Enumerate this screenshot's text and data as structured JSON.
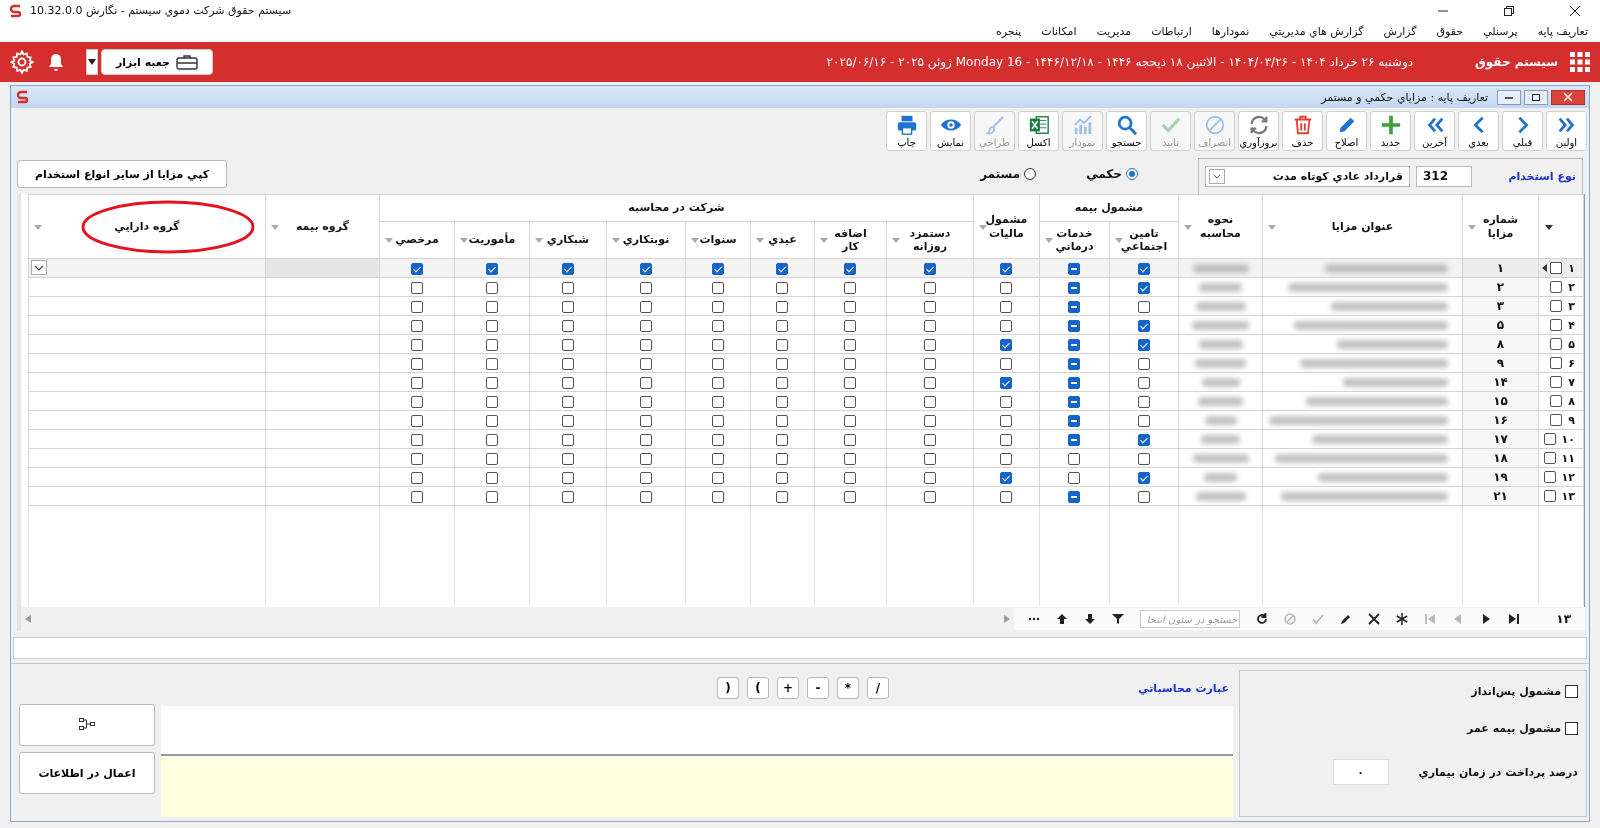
{
  "app_title": "سيستم حقوق شرکت دموي سيستم - نگارش 10.32.0.0",
  "menu": [
    "تعاريف پايه",
    "پرسنلي",
    "حقوق",
    "گزارش",
    "گزارش هاي مديريتي",
    "نمودارها",
    "ارتباطات",
    "مديريت",
    "امکانات",
    "پنجره"
  ],
  "header_bar": {
    "system_name": "سيستم حقوق",
    "date": "دوشنبه ۲۶ خرداد ۱۴۰۴ - ۱۴۰۴/۰۳/۲۶ - الاثنين ۱۸ ذيحجه ۱۴۴۶ - ۱۴۴۶/۱۲/۱۸ - Monday 16 ژوئن ۲۰۲۵ - ۲۰۲۵/۰۶/۱۶",
    "toolbox": "جعبه ابزار"
  },
  "window": {
    "title": "تعاريف پايه : مزاياي حکمي و مستمر"
  },
  "toolbar": [
    {
      "label": "اولين",
      "kind": "first",
      "disabled": false
    },
    {
      "label": "قبلي",
      "kind": "prev",
      "disabled": false
    },
    {
      "label": "بعدي",
      "kind": "next",
      "disabled": false
    },
    {
      "label": "آخرين",
      "kind": "last",
      "disabled": false
    },
    {
      "label": "جديد",
      "kind": "new",
      "disabled": false
    },
    {
      "label": "اصلاح",
      "kind": "edit",
      "disabled": false
    },
    {
      "label": "حذف",
      "kind": "delete",
      "disabled": false
    },
    {
      "label": "بروزآوري",
      "kind": "refresh",
      "disabled": false
    },
    {
      "label": "انصراف",
      "kind": "cancel",
      "disabled": true
    },
    {
      "label": "تاييد",
      "kind": "confirm",
      "disabled": true
    },
    {
      "label": "جستجو",
      "kind": "search",
      "disabled": false
    },
    {
      "label": "نمودار",
      "kind": "chart",
      "disabled": true
    },
    {
      "label": "اکسل",
      "kind": "excel",
      "disabled": false
    },
    {
      "label": "طراحي",
      "kind": "design",
      "disabled": true
    },
    {
      "label": "نمايش",
      "kind": "view",
      "disabled": false
    },
    {
      "label": "چاپ",
      "kind": "print",
      "disabled": false
    }
  ],
  "employment": {
    "label": "نوع استخدام",
    "code": "312",
    "type": "قرارداد عادي کوتاه مدت"
  },
  "calc_type": [
    {
      "label": "حکمي",
      "selected": true
    },
    {
      "label": "مستمر",
      "selected": false
    }
  ],
  "copy_button": "کپي مزايا از ساير انواع استخدام",
  "table": {
    "columns": [
      {
        "label": "شماره\nمزايا"
      },
      {
        "label": "عنوان مزايا"
      },
      {
        "label": "نحوه\nمحاسبه"
      },
      {
        "label": "مشمول بيمه",
        "children": [
          {
            "label": "تامين\nاجتماعي"
          },
          {
            "label": "خدمات\nدرماني"
          }
        ]
      },
      {
        "label": "مشمول\nماليات"
      },
      {
        "label": "شرکت در محاسبه",
        "children": [
          {
            "label": "دستمزد\nروزانه"
          },
          {
            "label": "اضافه\nکار"
          },
          {
            "label": "عيدي"
          },
          {
            "label": "سنوات"
          },
          {
            "label": "نوبتکاري"
          },
          {
            "label": "شبکاري"
          },
          {
            "label": "مأموريت"
          },
          {
            "label": "مرخصي"
          }
        ]
      },
      {
        "label": "گروه بيمه"
      },
      {
        "label": "گروه دارايي",
        "circled": true
      }
    ],
    "rows": [
      {
        "index": "۱",
        "number": "۱",
        "selected": false,
        "current": true,
        "health_partial": true,
        "checks": [
          true,
          true,
          true,
          true,
          true,
          true,
          true,
          true,
          true,
          true
        ]
      },
      {
        "index": "۲",
        "number": "۲",
        "selected": false,
        "current": false,
        "health_partial": true,
        "checks": [
          true,
          false,
          false,
          false,
          false,
          false,
          false,
          false,
          false,
          false
        ]
      },
      {
        "index": "۳",
        "number": "۳",
        "selected": false,
        "current": false,
        "health_partial": true,
        "checks": [
          false,
          false,
          false,
          false,
          false,
          false,
          false,
          false,
          false,
          false
        ]
      },
      {
        "index": "۴",
        "number": "۵",
        "selected": false,
        "current": false,
        "health_partial": true,
        "checks": [
          true,
          false,
          false,
          false,
          false,
          false,
          false,
          false,
          false,
          false
        ]
      },
      {
        "index": "۵",
        "number": "۸",
        "selected": false,
        "current": false,
        "health_partial": true,
        "checks": [
          true,
          true,
          false,
          false,
          false,
          false,
          false,
          false,
          false,
          false
        ]
      },
      {
        "index": "۶",
        "number": "۹",
        "selected": false,
        "current": false,
        "health_partial": true,
        "checks": [
          false,
          false,
          false,
          false,
          false,
          false,
          false,
          false,
          false,
          false
        ]
      },
      {
        "index": "۷",
        "number": "۱۴",
        "selected": false,
        "current": false,
        "health_partial": true,
        "checks": [
          false,
          true,
          false,
          false,
          false,
          false,
          false,
          false,
          false,
          false
        ]
      },
      {
        "index": "۸",
        "number": "۱۵",
        "selected": false,
        "current": false,
        "health_partial": true,
        "checks": [
          false,
          false,
          false,
          false,
          false,
          false,
          false,
          false,
          false,
          false
        ]
      },
      {
        "index": "۹",
        "number": "۱۶",
        "selected": false,
        "current": false,
        "health_partial": true,
        "checks": [
          false,
          false,
          false,
          false,
          false,
          false,
          false,
          false,
          false,
          false
        ]
      },
      {
        "index": "۱۰",
        "number": "۱۷",
        "selected": false,
        "current": false,
        "health_partial": true,
        "checks": [
          true,
          false,
          false,
          false,
          false,
          false,
          false,
          false,
          false,
          false
        ]
      },
      {
        "index": "۱۱",
        "number": "۱۸",
        "selected": false,
        "current": false,
        "health_partial": false,
        "health_checked": false,
        "checks": [
          false,
          false,
          false,
          false,
          false,
          false,
          false,
          false,
          false,
          false
        ]
      },
      {
        "index": "۱۲",
        "number": "۱۹",
        "selected": false,
        "current": false,
        "health_partial": false,
        "health_checked": false,
        "checks": [
          true,
          true,
          false,
          false,
          false,
          false,
          false,
          false,
          false,
          false
        ]
      },
      {
        "index": "۱۳",
        "number": "۲۱",
        "selected": false,
        "current": false,
        "health_partial": true,
        "checks": [
          false,
          false,
          false,
          false,
          false,
          false,
          false,
          false,
          false,
          false
        ]
      }
    ]
  },
  "pager": {
    "count": "۱۳",
    "search_placeholder": "جستجو در ستون انتخا",
    "buttons": [
      {
        "kind": "end",
        "disabled": false
      },
      {
        "kind": "forward",
        "disabled": false
      },
      {
        "kind": "back",
        "disabled": true
      },
      {
        "kind": "start",
        "disabled": true
      },
      {
        "kind": "insert",
        "disabled": false
      },
      {
        "kind": "remove",
        "disabled": false
      },
      {
        "kind": "edit",
        "disabled": false
      },
      {
        "kind": "post",
        "disabled": true
      },
      {
        "kind": "cancel",
        "disabled": true
      },
      {
        "kind": "refresh",
        "disabled": false
      }
    ],
    "tools": [
      {
        "kind": "filter",
        "disabled": false
      },
      {
        "kind": "down",
        "disabled": false
      },
      {
        "kind": "up",
        "disabled": false
      },
      {
        "kind": "more",
        "disabled": false
      }
    ]
  },
  "bottom": {
    "options": [
      {
        "label": "مشمول پس‌انداز",
        "checked": false
      },
      {
        "label": "مشمول بيمه عمر",
        "checked": false
      }
    ],
    "sick_pay": {
      "label": "درصد پرداخت در زمان بيماري",
      "value": "۰"
    },
    "expression": {
      "label": "عبارت محاسباتي",
      "operators": [
        "/",
        "*",
        "-",
        "+",
        "(",
        ")"
      ]
    },
    "apply_button": "اعمال در اطلاعات"
  }
}
